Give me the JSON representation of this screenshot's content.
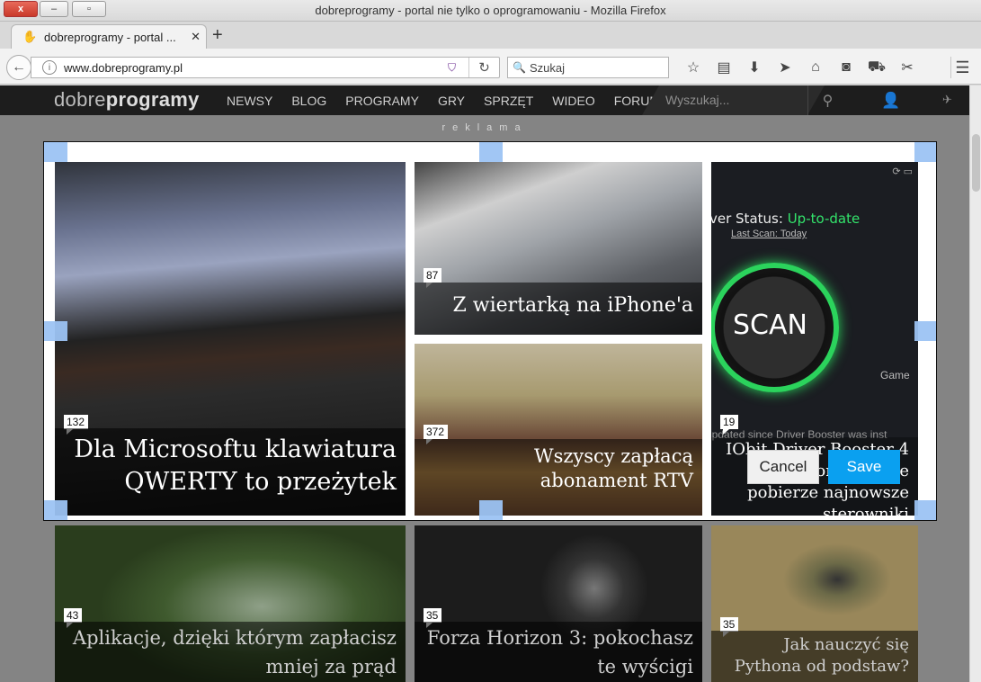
{
  "window": {
    "title": "dobreprogramy - portal nie tylko o oprogramowaniu - Mozilla Firefox",
    "close_glyph": "x",
    "min_glyph": "–",
    "max_glyph": "▫"
  },
  "tab": {
    "label": "dobreprogramy - portal ...",
    "close_glyph": "✕",
    "new_tab_glyph": "+"
  },
  "navbar": {
    "url": "www.dobreprogramy.pl",
    "search_placeholder": "Szukaj",
    "icons": [
      "bookmark-star-icon",
      "reading-list-icon",
      "download-icon",
      "send-icon",
      "home-icon",
      "pocket-icon",
      "extension-icon",
      "screenshot-icon"
    ]
  },
  "site": {
    "logo_light": "dobre",
    "logo_bold": "programy",
    "nav": [
      "NEWSY",
      "BLOG",
      "PROGRAMY",
      "GRY",
      "SPRZĘT",
      "WIDEO",
      "FORUM"
    ],
    "search_placeholder": "Wyszukaj...",
    "ad_label": "reklama"
  },
  "articles": [
    {
      "title": "Dla Microsoftu klawiatura QWERTY to przeżytek",
      "comments": "132"
    },
    {
      "title": "Z wiertarką na iPhone'a",
      "comments": "87"
    },
    {
      "title": "Wszyscy zapłacą abonament RTV",
      "comments": "372"
    },
    {
      "title": "IObit Driver Booster 4 automatycznie pobierze najnowsze sterowniki",
      "comments": "19"
    },
    {
      "title": "Aplikacje, dzięki którym zapłacisz mniej za prąd",
      "comments": "43"
    },
    {
      "title": "Forza Horizon 3: pokochasz te wyścigi",
      "comments": "35"
    },
    {
      "title": "Jak nauczyć się Pythona od podstaw?",
      "comments": "35"
    }
  ],
  "driver_booster": {
    "status_label": "ver Status:",
    "status_value": "Up-to-date",
    "last_scan": "Last Scan: Today",
    "scan": "SCAN",
    "game": "Game",
    "updated_note": "updated since Driver Booster was inst"
  },
  "screenshot_tool": {
    "cancel": "Cancel",
    "save": "Save"
  },
  "colors": {
    "status_green": "#33e36b",
    "save_blue": "#0aa0f0",
    "handle_blue": "#9cc3f3"
  }
}
